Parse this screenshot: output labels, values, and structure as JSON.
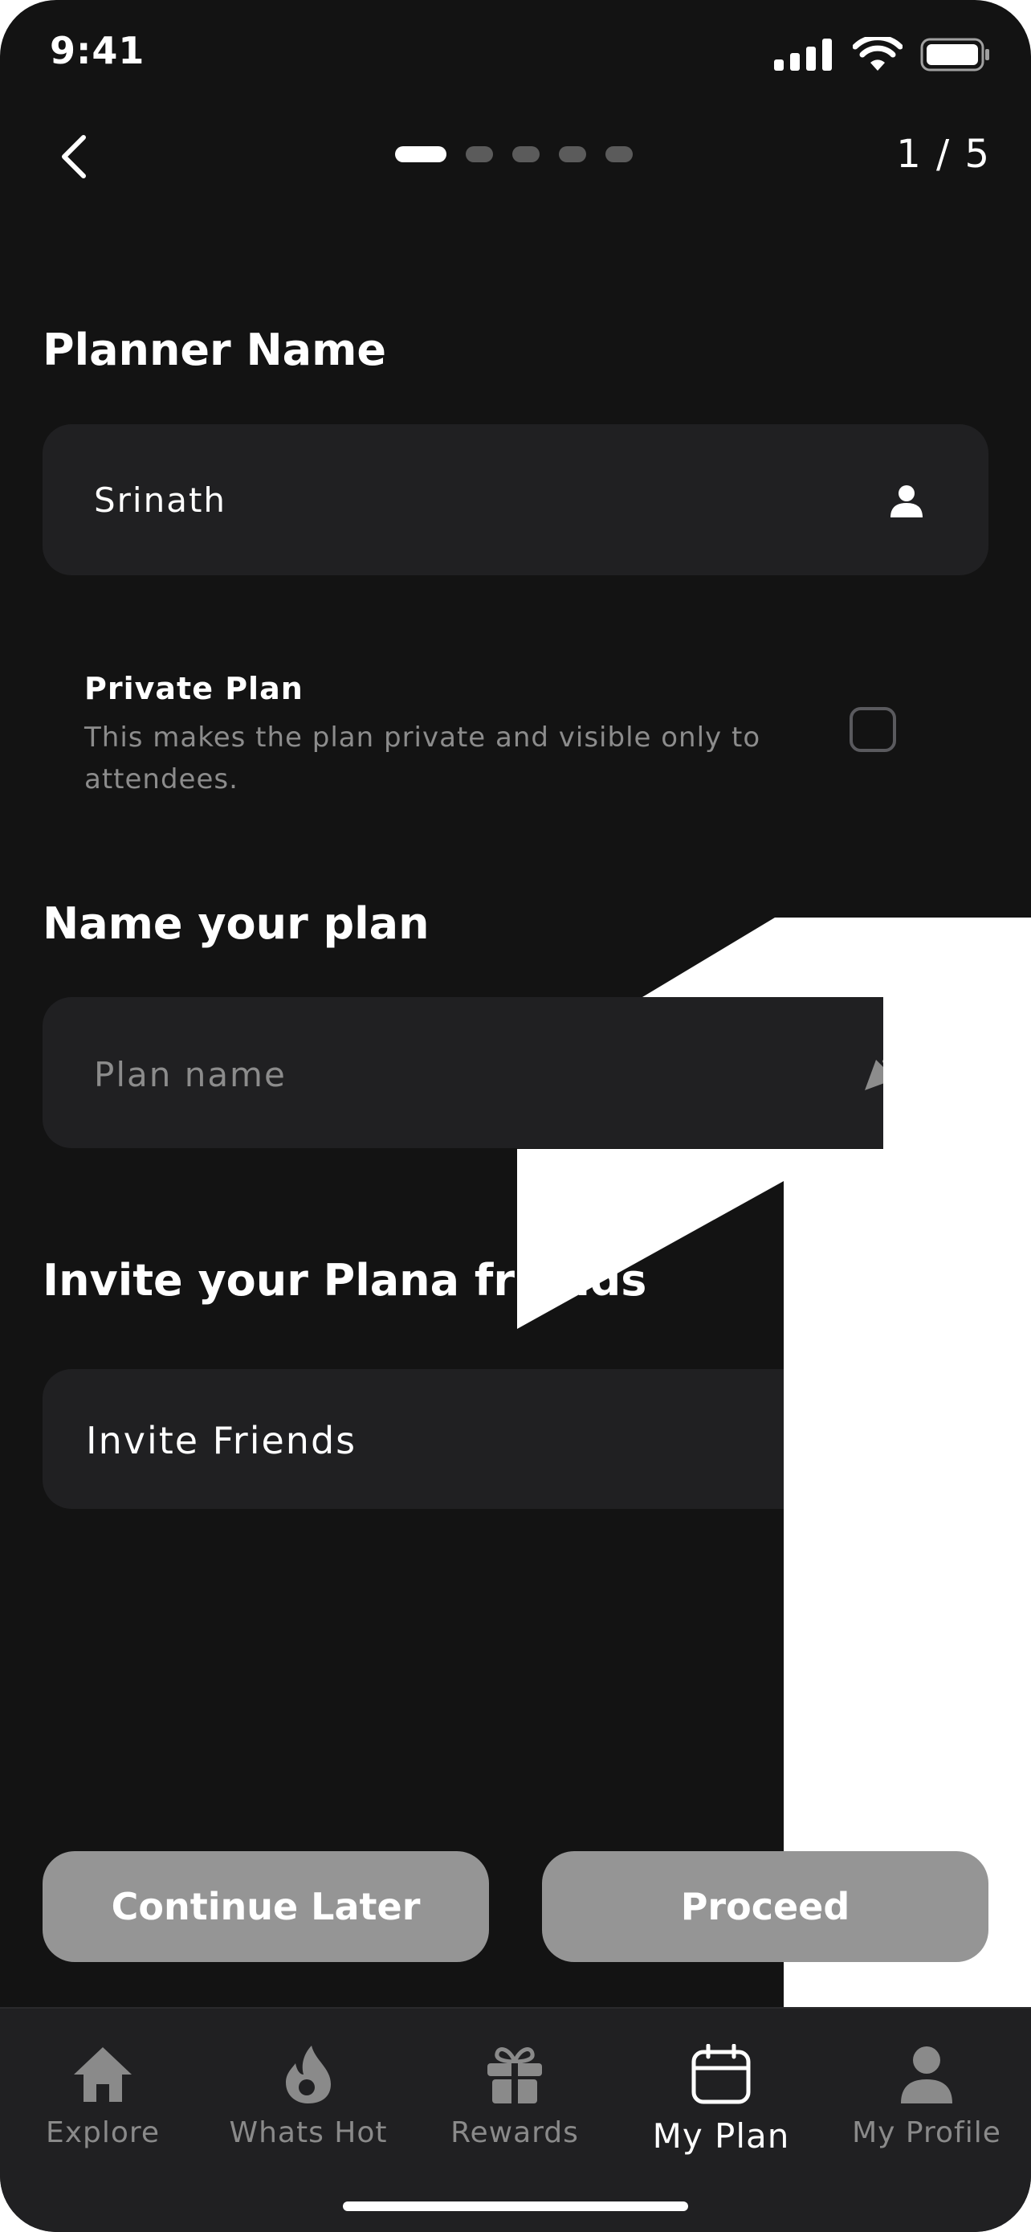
{
  "status": {
    "time": "9:41"
  },
  "header": {
    "step_current": 1,
    "step_total": 5,
    "step_text": "1 / 5"
  },
  "planner": {
    "label": "Planner Name",
    "value": "Srinath"
  },
  "private_plan": {
    "title": "Private Plan",
    "description": "This makes the plan private and visible only to attendees.",
    "checked": false
  },
  "plan_name": {
    "label": "Name your plan",
    "placeholder": "Plan name"
  },
  "invite": {
    "label": "Invite your Plana friends",
    "button_label": "Invite Friends"
  },
  "actions": {
    "continue_label": "Continue Later",
    "proceed_label": "Proceed"
  },
  "tabs": [
    {
      "label": "Explore",
      "icon": "home-icon",
      "active": false
    },
    {
      "label": "Whats Hot",
      "icon": "flame-icon",
      "active": false
    },
    {
      "label": "Rewards",
      "icon": "gift-icon",
      "active": false
    },
    {
      "label": "My Plan",
      "icon": "calendar-icon",
      "active": true
    },
    {
      "label": "My Profile",
      "icon": "profile-icon",
      "active": false
    }
  ],
  "colors": {
    "background": "#131313",
    "field": "#202022",
    "button": "#959595",
    "muted_text": "#8c8c8c"
  }
}
